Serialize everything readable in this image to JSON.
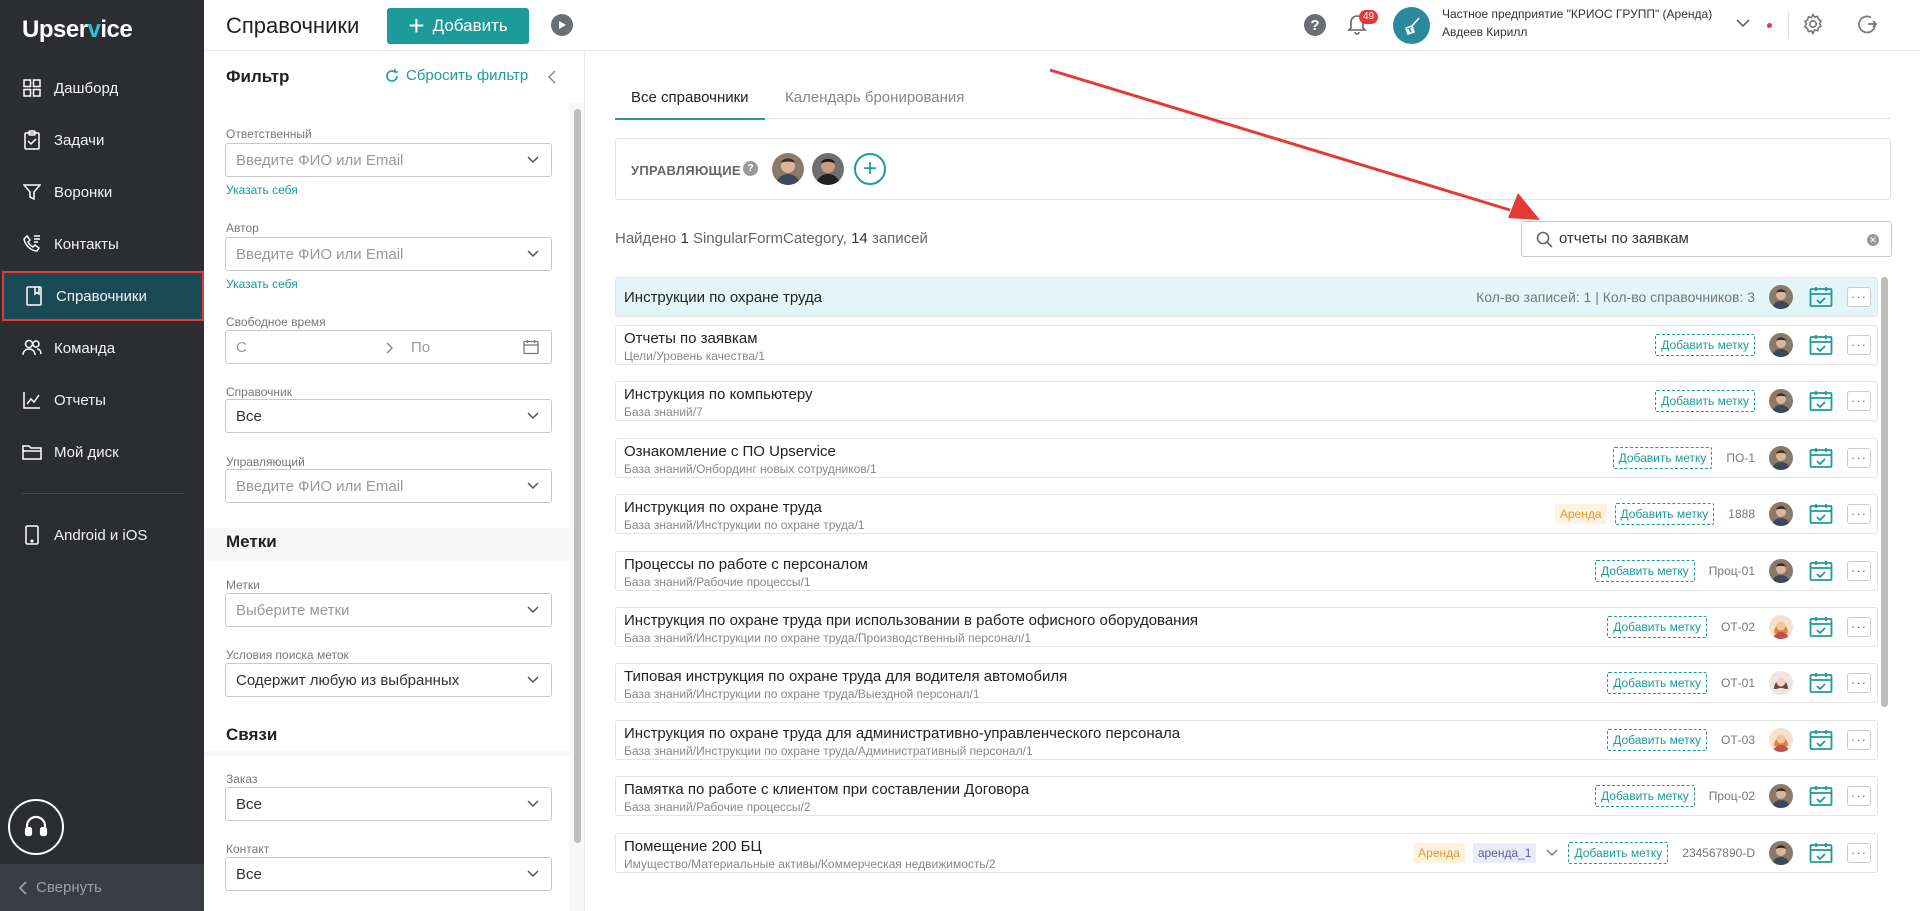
{
  "brand": {
    "logo_pre": "Upser",
    "logo_v": "v",
    "logo_post": "ice",
    "accent": "#1d9a9a",
    "nav_bg": "#2b2d30",
    "active_nav_bg": "#194a55"
  },
  "nav": {
    "items": [
      {
        "label": "Дашборд",
        "icon": "dashboard-icon"
      },
      {
        "label": "Задачи",
        "icon": "tasks-icon"
      },
      {
        "label": "Воронки",
        "icon": "funnel-icon"
      },
      {
        "label": "Контакты",
        "icon": "contacts-icon"
      },
      {
        "label": "Справочники",
        "icon": "book-icon",
        "active": true
      },
      {
        "label": "Команда",
        "icon": "team-icon"
      },
      {
        "label": "Отчеты",
        "icon": "reports-icon"
      },
      {
        "label": "Мой диск",
        "icon": "folder-icon"
      },
      {
        "label": "Android и iOS",
        "icon": "phone-icon"
      }
    ],
    "collapse_label": "Свернуть"
  },
  "header": {
    "title": "Справочники",
    "add_label": "Добавить",
    "notifications_count": "49",
    "org_name": "Частное предприятие \"КРИОС ГРУПП\" (Аренда)",
    "user_name": "Авдеев Кирилл"
  },
  "filter": {
    "title": "Фильтр",
    "reset_label": "Сбросить фильтр",
    "responsible": {
      "label": "Ответственный",
      "placeholder": "Введите ФИО или Email",
      "self_link": "Указать себя"
    },
    "author": {
      "label": "Автор",
      "placeholder": "Введите ФИО или Email",
      "self_link": "Указать себя"
    },
    "free_time": {
      "label": "Свободное время",
      "from": "С",
      "to": "По"
    },
    "directory": {
      "label": "Справочник",
      "value": "Все"
    },
    "manager": {
      "label": "Управляющий",
      "placeholder": "Введите ФИО или Email"
    },
    "tags_section": "Метки",
    "tags": {
      "label": "Метки",
      "placeholder": "Выберите метки"
    },
    "tag_search": {
      "label": "Условия поиска меток",
      "value": "Содержит любую из выбранных"
    },
    "links_section": "Связи",
    "order": {
      "label": "Заказ",
      "value": "Все"
    },
    "contact": {
      "label": "Контакт",
      "value": "Все"
    }
  },
  "tabs": [
    {
      "label": "Все справочники",
      "active": true
    },
    {
      "label": "Календарь бронирования",
      "active": false
    }
  ],
  "managers": {
    "label": "УПРАВЛЯЮЩИЕ",
    "help": "?"
  },
  "found": {
    "prefix": "Найдено",
    "categories": "1",
    "category_word": "SingularFormCategory,",
    "records": "14",
    "records_word": "записей"
  },
  "search": {
    "value": "отчеты по заявкам"
  },
  "group": {
    "title": "Инструкции по охране труда",
    "counts": "Кол-во записей: 1 | Кол-во справочников: 3"
  },
  "rows": [
    {
      "title": "Отчеты по заявкам",
      "path": "Цели/Уровень качества/1",
      "tag_add": "Добавить метку",
      "code": "",
      "avatar": "man"
    },
    {
      "title": "Инструкция по компьютеру",
      "path": "База знаний/7",
      "tag_add": "Добавить метку",
      "code": "",
      "avatar": "man"
    },
    {
      "title": "Ознакомление с ПО Upservice",
      "path": "База знаний/Онбординг новых сотрудников/1",
      "tag_add": "Добавить метку",
      "code": "ПО-1",
      "avatar": "man"
    },
    {
      "title": "Инструкция по охране труда",
      "path": "База знаний/Инструкции по охране труда/1",
      "tag_add": "Добавить метку",
      "code": "1888",
      "tag_arenda": "Аренда",
      "avatar": "man"
    },
    {
      "title": "Процессы по работе с персоналом",
      "path": "База знаний/Рабочие процессы/1",
      "tag_add": "Добавить метку",
      "code": "Проц-01",
      "avatar": "man"
    },
    {
      "title": "Инструкция по охране труда при использовании в работе офисного оборудования",
      "path": "База знаний/Инструкции по охране труда/Производственный персонал/1",
      "tag_add": "Добавить метку",
      "code": "ОТ-02",
      "avatar": "woman1"
    },
    {
      "title": "Типовая инструкция по охране труда для водителя автомобиля",
      "path": "База знаний/Инструкции по охране труда/Выездной персонал/1",
      "tag_add": "Добавить метку",
      "code": "ОТ-01",
      "avatar": "woman2"
    },
    {
      "title": "Инструкция по охране труда для административно-управленческого персонала",
      "path": "База знаний/Инструкции по охране труда/Административный персонал/1",
      "tag_add": "Добавить метку",
      "code": "ОТ-03",
      "avatar": "woman1"
    },
    {
      "title": "Памятка по работе с клиентом при составлении Договора",
      "path": "База знаний/Рабочие процессы/2",
      "tag_add": "Добавить метку",
      "code": "Проц-02",
      "avatar": "man"
    },
    {
      "title": "Помещение 200 БЦ",
      "path": "Имущество/Материальные активы/Коммерческая недвижимость/2",
      "tag_add": "Добавить метку",
      "code": "234567890-D",
      "tag_arenda": "Аренда",
      "tag_arenda1": "аренда_1",
      "avatar": "man"
    }
  ]
}
